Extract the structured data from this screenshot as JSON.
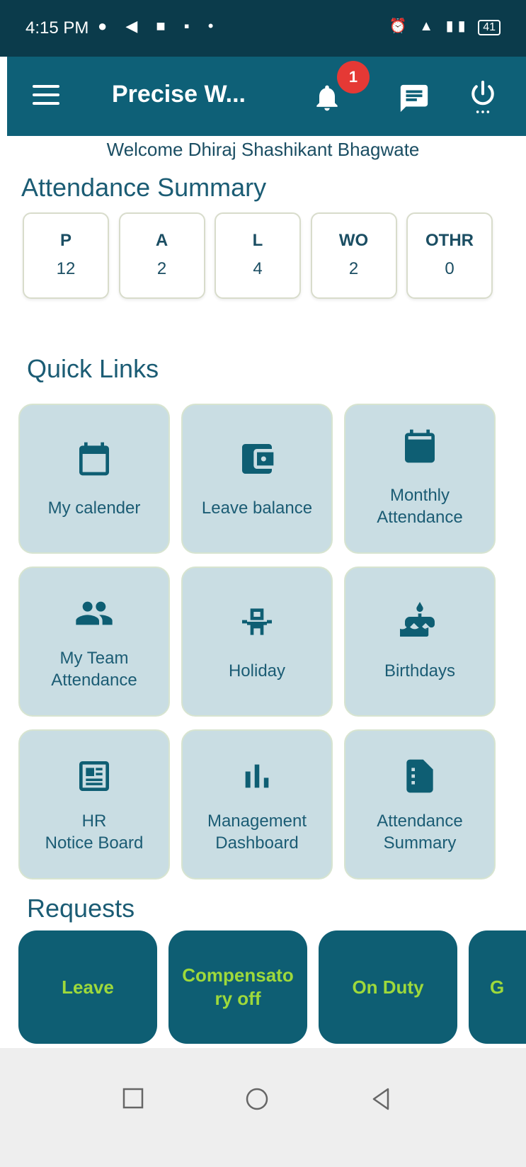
{
  "status_bar": {
    "time": "4:15 PM",
    "battery": "41"
  },
  "app_bar": {
    "title": "Precise W...",
    "notification_count": "1"
  },
  "welcome_text": "Welcome Dhiraj Shashikant Bhagwate",
  "attendance_summary": {
    "title": "Attendance Summary",
    "cards": [
      {
        "label": "P",
        "value": "12"
      },
      {
        "label": "A",
        "value": "2"
      },
      {
        "label": "L",
        "value": "4"
      },
      {
        "label": "WO",
        "value": "2"
      },
      {
        "label": "OTHR",
        "value": "0"
      }
    ]
  },
  "quick_links": {
    "title": "Quick Links",
    "items": [
      {
        "line1": "My calender",
        "line2": "",
        "icon": "calendar-icon"
      },
      {
        "line1": "Leave balance",
        "line2": "",
        "icon": "wallet-icon"
      },
      {
        "line1": "Monthly",
        "line2": "Attendance",
        "icon": "calendar-filled-icon"
      },
      {
        "line1": "My Team",
        "line2": "Attendance",
        "icon": "people-icon"
      },
      {
        "line1": "Holiday",
        "line2": "",
        "icon": "chair-icon"
      },
      {
        "line1": "Birthdays",
        "line2": "",
        "icon": "cake-icon"
      },
      {
        "line1": "HR",
        "line2": "Notice Board",
        "icon": "newspaper-icon"
      },
      {
        "line1": "Management",
        "line2": "Dashboard",
        "icon": "bar-chart-icon"
      },
      {
        "line1": "Attendance",
        "line2": "Summary",
        "icon": "document-icon"
      }
    ]
  },
  "requests": {
    "title": "Requests",
    "buttons": [
      {
        "line1": "Leave",
        "line2": ""
      },
      {
        "line1": "Compensato",
        "line2": "ry off"
      },
      {
        "line1": "On Duty",
        "line2": ""
      },
      {
        "line1": "G",
        "line2": ""
      }
    ]
  },
  "colors": {
    "primary": "#0e6077",
    "accent_text": "#9ed93b",
    "tile_bg": "#c9dde3",
    "badge": "#e53935"
  }
}
